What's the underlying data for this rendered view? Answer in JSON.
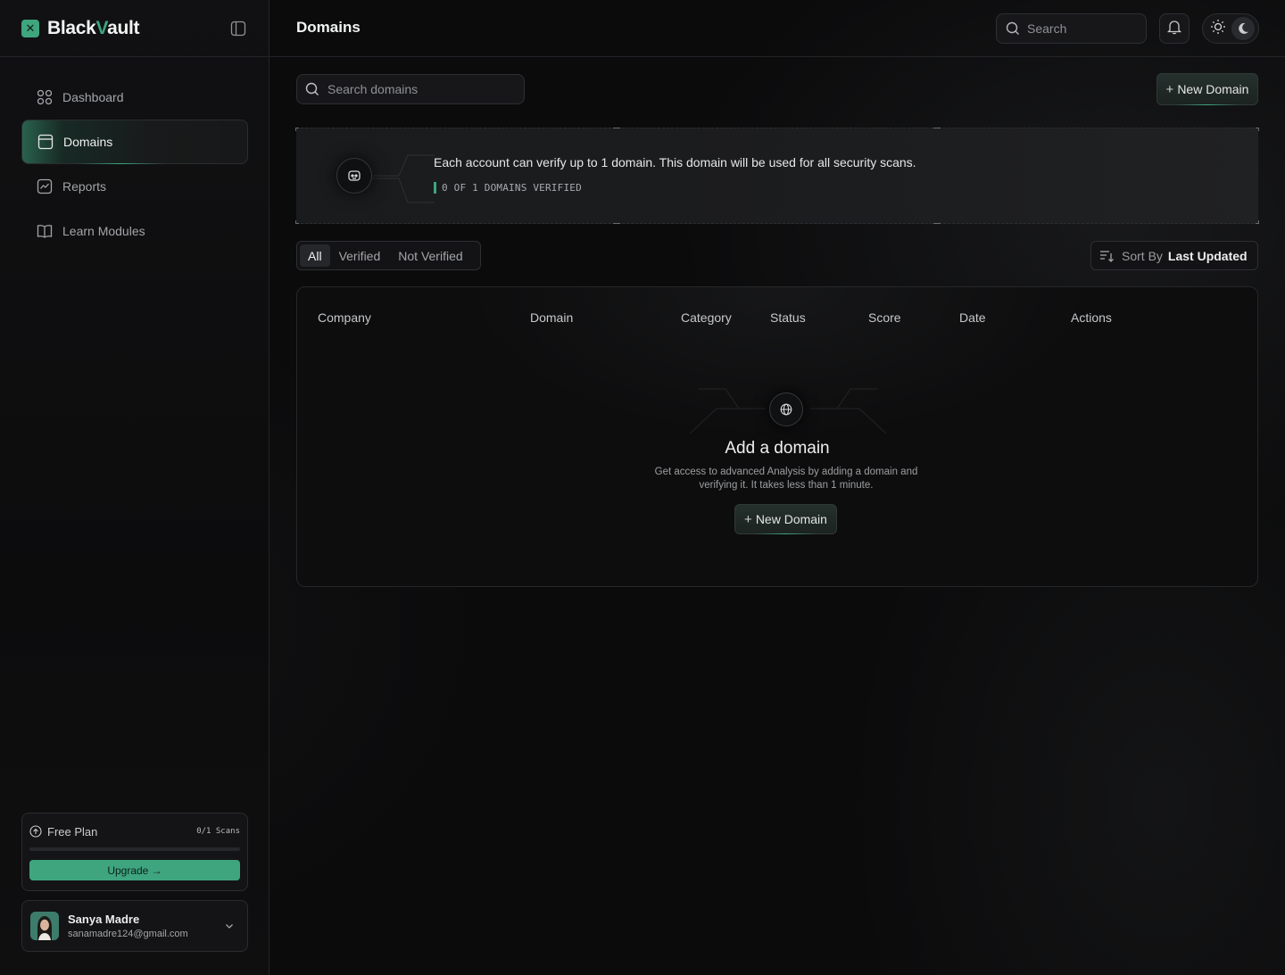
{
  "app": {
    "name_prefix": "Black",
    "name_accent": "V",
    "name_suffix": "ault",
    "logo_glyph": "✕",
    "accent_color": "#3ea57f"
  },
  "header": {
    "title": "Domains",
    "search_placeholder": "Search"
  },
  "sidebar": {
    "items": [
      {
        "label": "Dashboard",
        "icon": "grid-icon",
        "active": false
      },
      {
        "label": "Domains",
        "icon": "browser-window-icon",
        "active": true
      },
      {
        "label": "Reports",
        "icon": "chart-line-icon",
        "active": false
      },
      {
        "label": "Learn Modules",
        "icon": "book-open-icon",
        "active": false
      }
    ],
    "plan": {
      "name": "Free Plan",
      "scans": "0/1 Scans",
      "progress": 0,
      "upgrade_label": "Upgrade →"
    },
    "user": {
      "name": "Sanya Madre",
      "email": "sanamadre124@gmail.com"
    }
  },
  "toolbar": {
    "search_placeholder": "Search domains",
    "new_domain_label": "New Domain"
  },
  "banner": {
    "message": "Each account can verify up to 1 domain. This domain will be used for all security scans.",
    "status": "0 OF 1 DOMAINS VERIFIED"
  },
  "filters": {
    "tabs": [
      "All",
      "Verified",
      "Not Verified"
    ],
    "active_tab": "All"
  },
  "sort": {
    "label": "Sort By",
    "value": "Last Updated"
  },
  "table": {
    "columns": [
      "Company",
      "Domain",
      "Category",
      "Status",
      "Score",
      "Date",
      "Actions"
    ],
    "rows": []
  },
  "empty_state": {
    "title": "Add a domain",
    "description": "Get access to advanced Analysis by adding a domain and verifying it. It takes less than 1 minute.",
    "button_label": "New Domain"
  }
}
